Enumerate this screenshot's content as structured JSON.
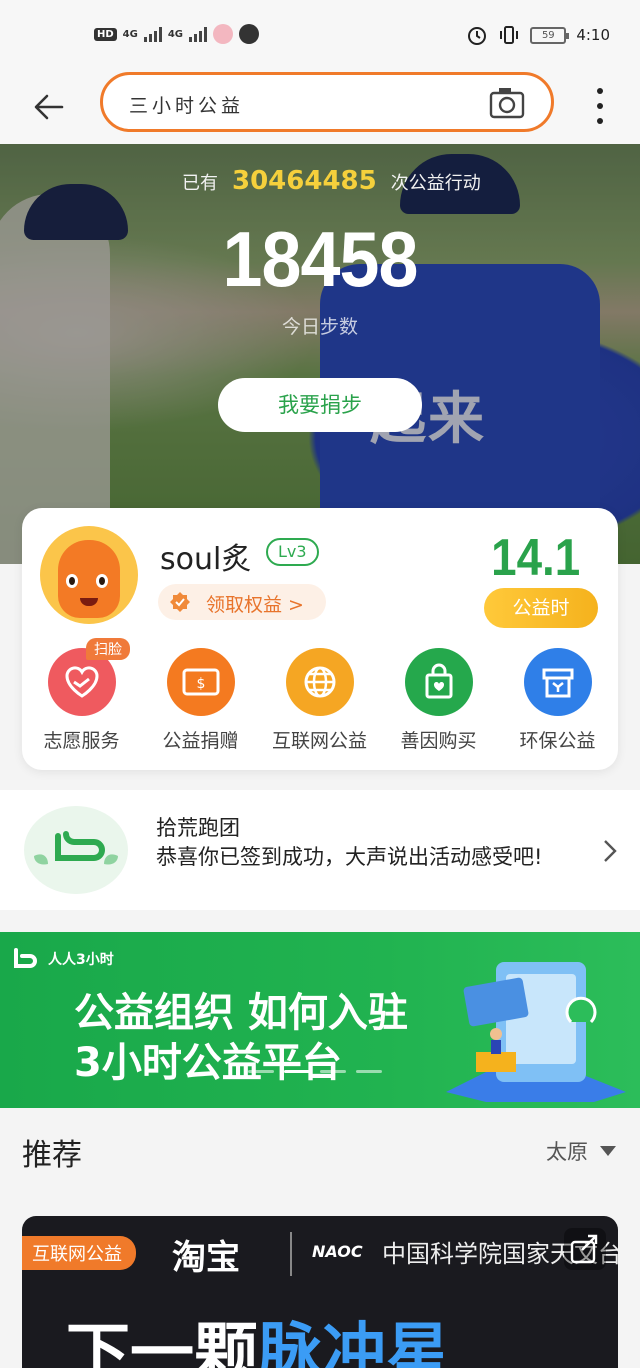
{
  "status_bar": {
    "net1": "4G",
    "net2": "4G",
    "battery": "59",
    "time": "4:10"
  },
  "search": {
    "query": "三小时公益"
  },
  "hero": {
    "prefix": "已有",
    "actions_count": "30464485",
    "suffix": "次公益行动",
    "steps": "18458",
    "steps_label": "今日步数",
    "donate_label": "我要捐步",
    "vest_text": "起来"
  },
  "profile": {
    "username": "soul炙",
    "level": "Lv3",
    "benefit_label": "领取权益 >",
    "hours_value": "14.1",
    "hours_label": "公益时"
  },
  "services": [
    {
      "label": "志愿服务",
      "color": "#ef5a5f",
      "icon": "heart-hand-icon",
      "tag": "扫脸"
    },
    {
      "label": "公益捐赠",
      "color": "#f47a20",
      "icon": "money-icon"
    },
    {
      "label": "互联网公益",
      "color": "#f5a623",
      "icon": "globe-icon"
    },
    {
      "label": "善因购买",
      "color": "#25a84c",
      "icon": "shopping-bag-icon"
    },
    {
      "label": "环保公益",
      "color": "#2f7fe8",
      "icon": "recycle-box-icon"
    }
  ],
  "club": {
    "name": "拾荒跑团",
    "message": "恭喜你已签到成功，大声说出活动感受吧!"
  },
  "banner": {
    "brand": "人人3小时",
    "title_line1": "公益组织 如何入驻",
    "title_line2": "3小时公益平台"
  },
  "recommend": {
    "title": "推荐",
    "city": "太原"
  },
  "feed": {
    "tag": "互联网公益",
    "brand": "淘宝",
    "partner_short": "NAOC",
    "partner_name": "中国科学院国家天文台",
    "headline_part1": "下一颗",
    "headline_part2": "脉冲星"
  },
  "colors": {
    "accent_green": "#2aa24b",
    "accent_orange": "#f07a2a",
    "gold": "#f5b21d"
  }
}
